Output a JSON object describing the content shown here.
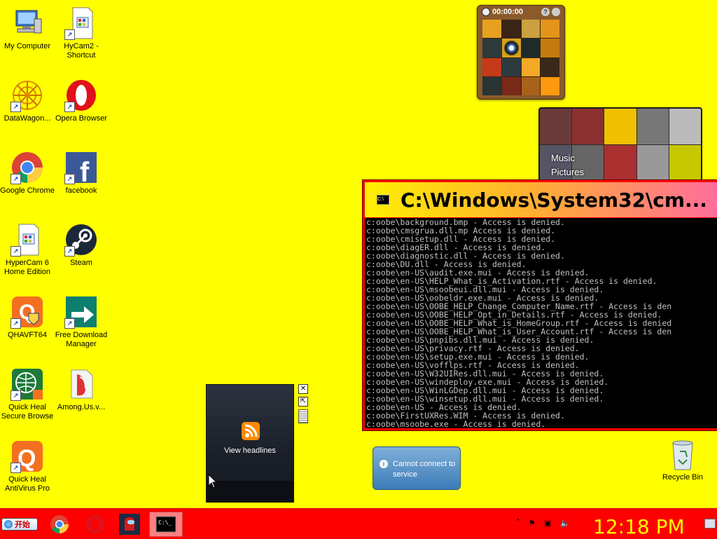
{
  "desktop_icons": [
    {
      "label": "My Computer",
      "icon": "my-computer-icon"
    },
    {
      "label": "HyCam2 - Shortcut",
      "icon": "hycam-icon"
    },
    {
      "label": "DataWagon...",
      "icon": "datawagon-icon"
    },
    {
      "label": "Opera Browser",
      "icon": "opera-icon"
    },
    {
      "label": "Google Chrome",
      "icon": "chrome-icon"
    },
    {
      "label": "facebook",
      "icon": "facebook-icon"
    },
    {
      "label": "HyperCam 6 Home Edition",
      "icon": "hypercam-icon"
    },
    {
      "label": "Steam",
      "icon": "steam-icon"
    },
    {
      "label": "QHAVFT64",
      "icon": "qhavft-icon"
    },
    {
      "label": "Free Download Manager",
      "icon": "fdm-icon"
    },
    {
      "label": "Quick Heal Secure Browse",
      "icon": "secure-browse-icon"
    },
    {
      "label": "Among.Us.v...",
      "icon": "zip-folder-icon"
    },
    {
      "label": "Quick Heal AntiVirus Pro",
      "icon": "quickheal-icon"
    }
  ],
  "recycle_bin": {
    "label": "Recycle Bin"
  },
  "puzzle_gadget": {
    "timer": "00:00:00",
    "help": "?"
  },
  "media_gadget": {
    "music": "Music",
    "pictures": "Pictures"
  },
  "cmd_window": {
    "title": "C:\\Windows\\System32\\cm...",
    "lines": [
      "c:oobe\\background.bmp - Access is denied.",
      "c:oobe\\cmsgrua.dll.mp Access is denied.",
      "c:oobe\\cmisetup.dll - Access is denied.",
      "c:oobe\\diagER.dll - Access is denied.",
      "c:oobe\\diagnostic.dll - Access is denied.",
      "c:oobe\\DU.dll - Access is denied.",
      "c:oobe\\en-US\\audit.exe.mui - Access is denied.",
      "c:oobe\\en-US\\HELP_What_is_Activation.rtf - Access is denied.",
      "c:oobe\\en-US\\msoobeui.dll.mui - Access is denied.",
      "c:oobe\\en-US\\oobeldr.exe.mui - Access is denied.",
      "c:oobe\\en-US\\OOBE_HELP_Change_Computer_Name.rtf - Access is den",
      "c:oobe\\en-US\\OOBE_HELP_Opt_in_Details.rtf - Access is denied.",
      "c:oobe\\en-US\\OOBE_HELP_What_is_HomeGroup.rtf - Access is denied",
      "c:oobe\\en-US\\OOBE_HELP_What_is_User_Account.rtf - Access is den",
      "c:oobe\\en-US\\pnpibs.dll.mui - Access is denied.",
      "c:oobe\\en-US\\privacy.rtf - Access is denied.",
      "c:oobe\\en-US\\setup.exe.mui - Access is denied.",
      "c:oobe\\en-US\\vofflps.rtf - Access is denied.",
      "c:oobe\\en-US\\W32UIRes.dll.mui - Access is denied.",
      "c:oobe\\en-US\\windeploy.exe.mui - Access is denied.",
      "c:oobe\\en-US\\WinLGDep.dll.mui - Access is denied.",
      "c:oobe\\en-US\\winsetup.dll.mui - Access is denied.",
      "c:oobe\\en-US - Access is denied.",
      "c:oobe\\FirstUXRes.WIM - Access is denied.",
      "c:oobe\\msoobe.exe - Access is denied."
    ]
  },
  "headlines_gadget": {
    "label": "View headlines"
  },
  "notice": {
    "text": "Cannot connect to service"
  },
  "taskbar": {
    "start_label": "开始",
    "clock": "12:18 PM",
    "pinned": [
      "chrome-icon",
      "opera-icon",
      "among-us-icon",
      "cmd-icon"
    ]
  },
  "colors": {
    "desktop": "#ffff00",
    "taskbar": "#ff0000",
    "clock": "#ffff00",
    "cmd_border": "#ff0000"
  }
}
